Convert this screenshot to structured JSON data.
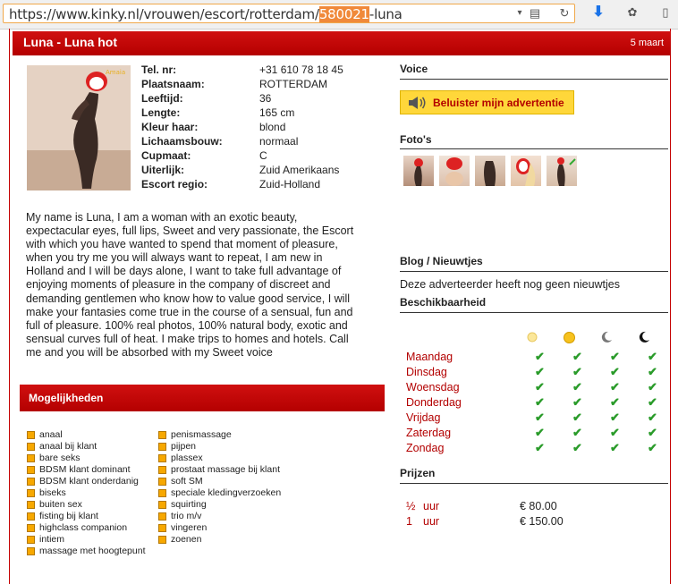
{
  "browser": {
    "url_prefix": "https://www.kinky.nl/vrouwen/escort/rotterdam/",
    "url_highlight": "580021",
    "url_suffix": "-luna"
  },
  "ad": {
    "title": "Luna - Luna hot",
    "date": "5 maart"
  },
  "profile": [
    {
      "label": "Tel. nr:",
      "value": "+31 610 78 18 45"
    },
    {
      "label": "Plaatsnaam:",
      "value": "ROTTERDAM"
    },
    {
      "label": "Leeftijd:",
      "value": "36"
    },
    {
      "label": "Lengte:",
      "value": "165 cm"
    },
    {
      "label": "Kleur haar:",
      "value": "blond"
    },
    {
      "label": "Lichaamsbouw:",
      "value": "normaal"
    },
    {
      "label": "Cupmaat:",
      "value": "C"
    },
    {
      "label": "Uiterlijk:",
      "value": "Zuid Amerikaans"
    },
    {
      "label": "Escort regio:",
      "value": "Zuid-Holland"
    }
  ],
  "description": "My name is Luna, I am a woman with an exotic beauty, expectacular eyes, full lips, Sweet and very passionate, the Escort with which you have wanted to spend that moment of pleasure, when you try me you will always want to repeat, I am new in Holland and I will be days alone, I want to take full advantage of enjoying moments of pleasure in the company of discreet and demanding gentlemen who know how to value good service, I will make your fantasies come true in the course of a sensual, fun and full of pleasure. 100% real photos, 100% natural body, exotic and sensual curves full of heat. I make trips to homes and hotels. Call me and you will be absorbed with my Sweet voice",
  "mogelijkheden": {
    "title": "Mogelijkheden",
    "col1": [
      "anaal",
      "anaal bij klant",
      "bare seks",
      "BDSM klant dominant",
      "BDSM klant onderdanig",
      "biseks",
      "buiten sex",
      "fisting bij klant",
      "highclass companion",
      "intiem",
      "massage met hoogtepunt"
    ],
    "col2": [
      "penismassage",
      "pijpen",
      "plassex",
      "prostaat massage bij klant",
      "soft SM",
      "speciale kledingverzoeken",
      "squirting",
      "trio m/v",
      "vingeren",
      "zoenen"
    ]
  },
  "voice": {
    "title": "Voice",
    "button_label": "Beluister mijn advertentie"
  },
  "photos_title": "Foto's",
  "blog": {
    "title": "Blog / Nieuwtjes",
    "empty": "Deze adverteerder heeft nog geen nieuwtjes"
  },
  "availability": {
    "title": "Beschikbaarheid",
    "days": [
      "Maandag",
      "Dinsdag",
      "Woensdag",
      "Donderdag",
      "Vrijdag",
      "Zaterdag",
      "Zondag"
    ],
    "slots": [
      "morning-sun-icon",
      "afternoon-sun-icon",
      "evening-moon-icon",
      "night-moon-icon"
    ],
    "checkmark": "✔"
  },
  "prices": {
    "title": "Prijzen",
    "rows": [
      {
        "amount": "½",
        "unit": "uur",
        "price": "€ 80.00"
      },
      {
        "amount": "1",
        "unit": "uur",
        "price": "€ 150.00"
      }
    ]
  }
}
